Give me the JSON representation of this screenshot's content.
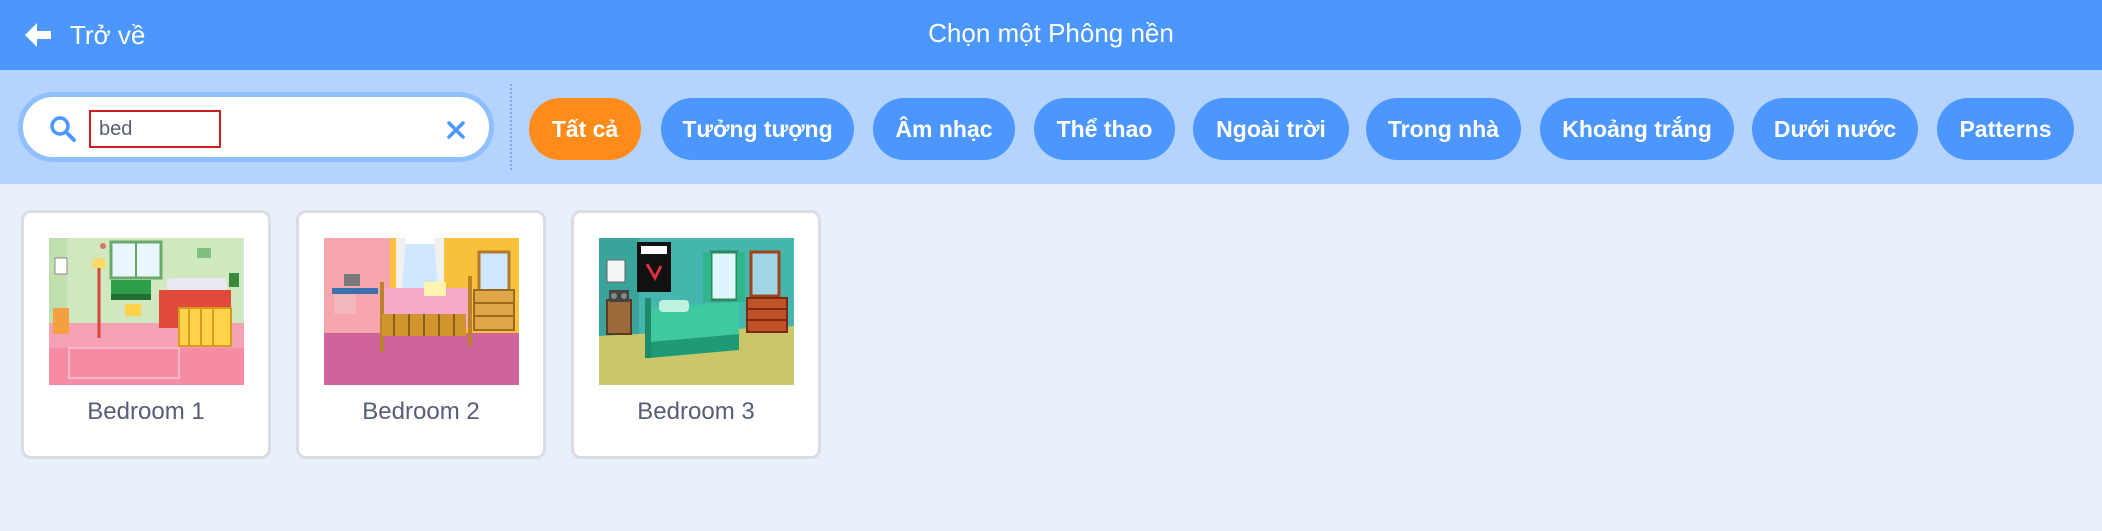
{
  "header": {
    "back_label": "Trở về",
    "title": "Chọn một Phông nền",
    "color": "#4c97ff"
  },
  "search": {
    "value": "bed",
    "search_icon": "magnifier-icon",
    "clear_icon": "close-x-icon"
  },
  "filters": [
    {
      "label": "Tất cả",
      "active": true
    },
    {
      "label": "Tưởng tượng",
      "active": false
    },
    {
      "label": "Âm nhạc",
      "active": false
    },
    {
      "label": "Thể thao",
      "active": false
    },
    {
      "label": "Ngoài trời",
      "active": false
    },
    {
      "label": "Trong nhà",
      "active": false
    },
    {
      "label": "Khoảng trắng",
      "active": false
    },
    {
      "label": "Dưới nước",
      "active": false
    },
    {
      "label": "Patterns",
      "active": false
    }
  ],
  "colors": {
    "active_filter": "#ff8c1a",
    "filter": "#4c97ff",
    "filter_bar": "#b5d3ff",
    "page_bg": "#e8f0fb"
  },
  "backdrops": [
    {
      "name": "Bedroom 1"
    },
    {
      "name": "Bedroom 2"
    },
    {
      "name": "Bedroom 3"
    }
  ]
}
